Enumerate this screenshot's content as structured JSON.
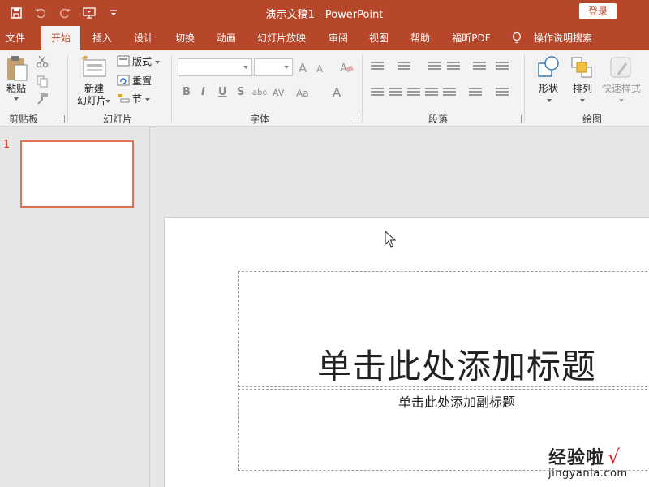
{
  "window": {
    "title": "演示文稿1  -  PowerPoint",
    "login_label": "登录"
  },
  "qat": {
    "icons": [
      "save-icon",
      "undo-icon",
      "redo-icon",
      "present-icon",
      "customize-icon"
    ]
  },
  "tabs": [
    {
      "label": "文件"
    },
    {
      "label": "开始"
    },
    {
      "label": "插入"
    },
    {
      "label": "设计"
    },
    {
      "label": "切换"
    },
    {
      "label": "动画"
    },
    {
      "label": "幻灯片放映"
    },
    {
      "label": "审阅"
    },
    {
      "label": "视图"
    },
    {
      "label": "帮助"
    },
    {
      "label": "福昕PDF"
    },
    {
      "label": "操作说明搜索"
    }
  ],
  "ribbon": {
    "clipboard": {
      "label": "剪贴板",
      "paste": "粘贴"
    },
    "slides": {
      "label": "幻灯片",
      "new_slide_line1": "新建",
      "new_slide_line2": "幻灯片",
      "layout": "版式",
      "reset": "重置",
      "section": "节"
    },
    "font": {
      "label": "字体",
      "bold": "B",
      "italic": "I",
      "underline": "U",
      "shadow": "S",
      "strike": "abc",
      "spacing": "AV",
      "case": "Aa",
      "color": "A"
    },
    "paragraph": {
      "label": "段落"
    },
    "drawing": {
      "label": "绘图",
      "shapes": "形状",
      "arrange": "排列",
      "quick_styles": "快速样式"
    }
  },
  "accent_color": "#b7472a",
  "thumbnail": {
    "number": "1"
  },
  "slide": {
    "title_placeholder": "单击此处添加标题",
    "subtitle_placeholder": "单击此处添加副标题"
  },
  "watermark": {
    "text": "经验啦",
    "check": "√",
    "url": "jingyanla.com"
  }
}
